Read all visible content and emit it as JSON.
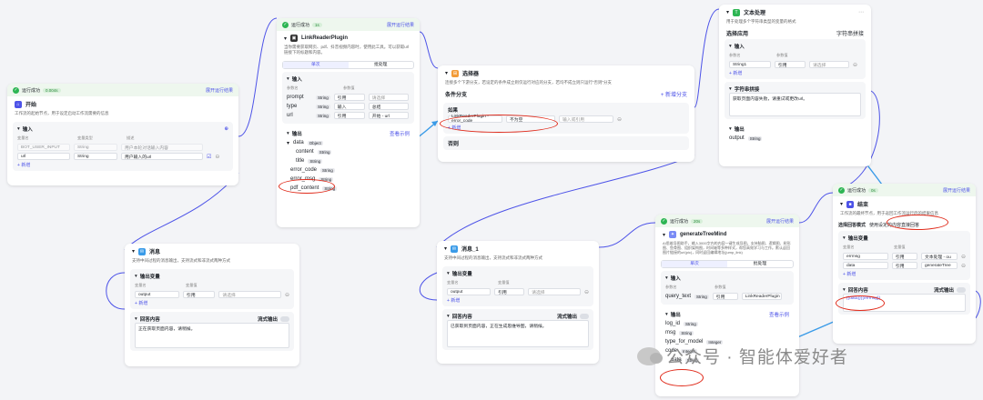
{
  "strip": {
    "success": "运行成功",
    "rerun": "展开运行结果"
  },
  "start": {
    "time": "0.004s",
    "title": "开始",
    "desc": "工作流的起始节点，用于设定启动工作流需要的信息",
    "input_head": "输入",
    "cols": [
      "变量名",
      "变量类型",
      "描述"
    ],
    "ghost": [
      "BOT_USER_INPUT",
      "String",
      "用户本轮对话输入内容"
    ],
    "var_name": "url",
    "var_type": "String",
    "var_desc": "用户输入的url",
    "add": "新增"
  },
  "plugin": {
    "time": "1s",
    "title": "LinkReaderPlugin",
    "desc": "当你需要获取网页、pdf、抖音视频内容时，使用此工具。可以获取url链接下的标题和内容。",
    "tabs": [
      "单次",
      "批处理"
    ],
    "input_head": "输入",
    "cols": [
      "参数名",
      "参数值"
    ],
    "inputs": [
      {
        "name": "prompt",
        "type": "String",
        "mode": "引用",
        "value": "请选择"
      },
      {
        "name": "type",
        "type": "String",
        "mode": "输入",
        "value": "总结"
      },
      {
        "name": "url",
        "type": "String",
        "mode": "引用",
        "value": "开始 - url"
      }
    ],
    "output_head": "输出",
    "view_example": "查看示例",
    "outputs": [
      {
        "name": "data",
        "type": "Object"
      },
      {
        "name": "content",
        "type": "String"
      },
      {
        "name": "title",
        "type": "String"
      },
      {
        "name": "error_code",
        "type": "String"
      },
      {
        "name": "error_msg",
        "type": "String"
      },
      {
        "name": "pdf_content",
        "type": "String"
      }
    ]
  },
  "selector": {
    "title": "选择器",
    "desc": "连接多个下游分支，若设定的条件成立则仅运行对应的分支，若均不成立则只运行“否则”分支",
    "branch_head": "条件分支",
    "add_branch": "新增分支",
    "if_label": "如果",
    "cols": [
      "",
      "",
      "比较值"
    ],
    "ref": "LinkReaderPlugin - error_code",
    "op": "不为空",
    "placeholder": "输入或引用",
    "add": "新增",
    "else": "否则"
  },
  "msg1": {
    "title": "消息",
    "desc": "支持中间过程的消息输出，支持流式和非流式两种方式",
    "out_var": "输出变量",
    "cols": [
      "变量名",
      "变量值"
    ],
    "var": "output",
    "mode": "引用",
    "value": "请选择",
    "add": "新增",
    "content_head": "回答内容",
    "stream": "流式输出",
    "content": "正在获取页面内容，请稍候。"
  },
  "msg2": {
    "title": "消息_1",
    "desc": "支持中间过程的消息输出，支持流式和非流式两种方式",
    "out_var": "输出变量",
    "cols": [
      "变量名",
      "变量值"
    ],
    "var": "output",
    "mode": "引用",
    "value": "请选择",
    "add": "新增",
    "content_head": "回答内容",
    "stream": "流式输出",
    "content": "已获取到页面内容，正在生成思维导图，请稍候。"
  },
  "text": {
    "title": "文本处理",
    "desc": "用于处理多个字符串类型的变量的格式",
    "app_label": "选择应用",
    "app_value": "字符串拼接",
    "input_head": "输入",
    "cols": [
      "参数名",
      "参数值"
    ],
    "var": "String1",
    "mode": "引用",
    "value": "请选择",
    "add": "新增",
    "concat_head": "字符串拼接",
    "concat_text": "获取页面内容失败，请重试或更改url。",
    "output_head": "输出",
    "out_var": "output",
    "out_type": "String"
  },
  "tree": {
    "time": "20s",
    "title": "generateTreeMind",
    "desc": "AI思维导图助手，输入3000字内的内容一键生成导图，支持脑图、逻辑图、树形图、鱼骨图、组织架构图，时间轴等多种样式，帮您高效学习与工作。默认返回图片链接的url(pic)，同时返回编辑地址(jump_link)",
    "tabs": [
      "单次",
      "批处理"
    ],
    "input_head": "输入",
    "cols": [
      "参数名",
      "参数值"
    ],
    "in_name": "query_text",
    "in_type": "String",
    "in_mode": "引用",
    "in_value": "LinkReaderPlugin",
    "output_head": "输出",
    "view_example": "查看示例",
    "outputs": [
      {
        "name": "log_id",
        "type": "String"
      },
      {
        "name": "msg",
        "type": "String"
      },
      {
        "name": "type_for_model",
        "type": "Integer"
      },
      {
        "name": "code",
        "type": "Integer"
      },
      {
        "name": "data",
        "type": "String"
      }
    ]
  },
  "end": {
    "time": "0s",
    "title": "结束",
    "desc": "工作流的最终节点，用于返回工作流运行后的结果信息",
    "mode_label": "选择回答模式",
    "mode_value": "使用设定的内容直接回答",
    "out_var": "输出变量",
    "cols": [
      "变量名",
      "变量值"
    ],
    "vars": [
      {
        "name": "errmsg",
        "mode": "引用",
        "value": "文本处理 - ou"
      },
      {
        "name": "data",
        "mode": "引用",
        "value": "generateTree"
      }
    ],
    "add": "新增",
    "content_head": "回答内容",
    "stream": "流式输出",
    "content": "{{data}}{{errmsg}}"
  },
  "watermark": "公众号 · 智能体爱好者",
  "colors": {
    "accent": "#4d53e8",
    "success": "#2db553",
    "annot": "#e02b1b",
    "arrow": "#3a9be8"
  }
}
